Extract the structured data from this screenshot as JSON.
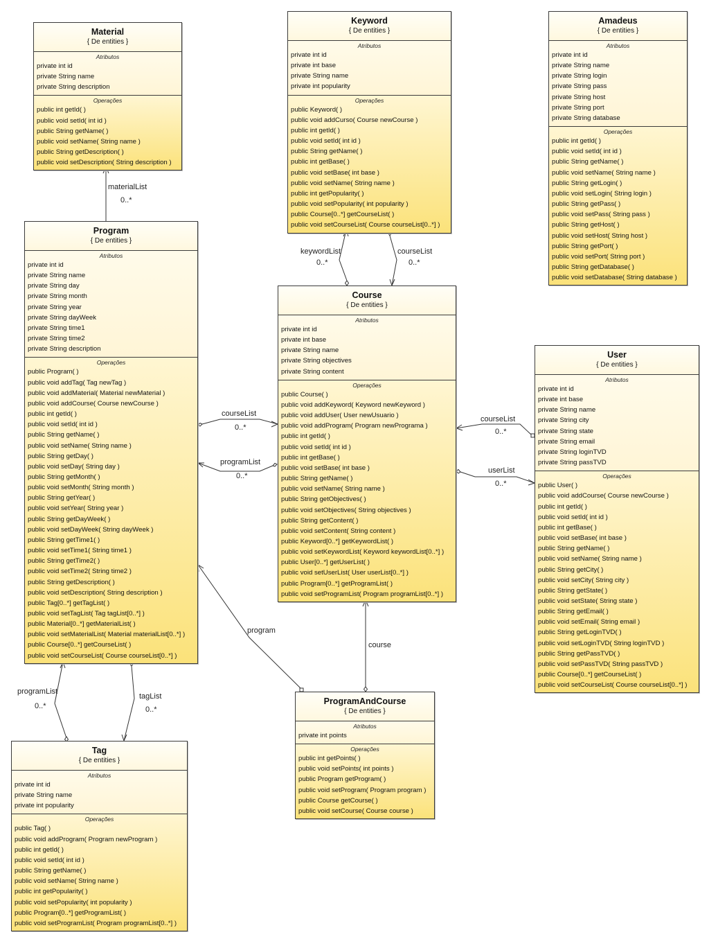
{
  "labels": {
    "attributes": "Atributos",
    "operations": "Operações"
  },
  "classes": {
    "material": {
      "name": "Material",
      "stereotype": "{ De entities }",
      "attributes": [
        "private int id",
        "private String name",
        "private String description"
      ],
      "operations": [
        "public int  getId(  )",
        "public void  setId( int id )",
        "public String  getName(  )",
        "public void  setName( String name )",
        "public String  getDescription(  )",
        "public void  setDescription( String description )"
      ]
    },
    "keyword": {
      "name": "Keyword",
      "stereotype": "{ De entities }",
      "attributes": [
        "private int id",
        "private int base",
        "private String name",
        "private int popularity"
      ],
      "operations": [
        "public Keyword(  )",
        "public void  addCurso( Course newCourse )",
        "public int  getId(  )",
        "public void  setId( int id )",
        "public String  getName(  )",
        "public int  getBase(  )",
        "public void  setBase( int base )",
        "public void  setName( String name )",
        "public int  getPopularity(  )",
        "public void  setPopularity( int popularity )",
        "public Course[0..*]  getCourseList(  )",
        "public void  setCourseList( Course courseList[0..*] )"
      ]
    },
    "amadeus": {
      "name": "Amadeus",
      "stereotype": "{ De entities }",
      "attributes": [
        "private int id",
        "private String name",
        "private String login",
        "private String pass",
        "private String host",
        "private String port",
        "private String database"
      ],
      "operations": [
        "public int  getId(  )",
        "public void  setId( int id )",
        "public String  getName(  )",
        "public void  setName( String name )",
        "public String  getLogin(  )",
        "public void  setLogin( String login )",
        "public String  getPass(  )",
        "public void  setPass( String pass )",
        "public String  getHost(  )",
        "public void  setHost( String host )",
        "public String  getPort(  )",
        "public void  setPort( String port )",
        "public String  getDatabase(  )",
        "public void  setDatabase( String database )"
      ]
    },
    "program": {
      "name": "Program",
      "stereotype": "{ De entities }",
      "attributes": [
        "private int id",
        "private String name",
        "private String day",
        "private String month",
        "private String year",
        "private String dayWeek",
        "private String time1",
        "private String time2",
        "private String description"
      ],
      "operations": [
        "public Program(  )",
        "public void  addTag( Tag newTag )",
        "public void  addMaterial( Material newMaterial )",
        "public void  addCourse( Course newCourse )",
        "public int  getId(  )",
        "public void  setId( int id )",
        "public String  getName(  )",
        "public void  setName( String name )",
        "public String  getDay(  )",
        "public void  setDay( String day )",
        "public String  getMonth(  )",
        "public void  setMonth( String month )",
        "public String  getYear(  )",
        "public void  setYear( String year )",
        "public String  getDayWeek(  )",
        "public void  setDayWeek( String dayWeek )",
        "public String  getTime1(  )",
        "public void  setTime1( String time1 )",
        "public String  getTime2(  )",
        "public void  setTime2( String time2 )",
        "public String  getDescription(  )",
        "public void  setDescription( String description )",
        "public Tag[0..*]  getTagList(  )",
        "public void  setTagList( Tag tagList[0..*] )",
        "public Material[0..*]  getMaterialList(  )",
        "public void  setMaterialList( Material materialList[0..*] )",
        "public Course[0..*]  getCourseList(  )",
        "public void  setCourseList( Course courseList[0..*] )"
      ]
    },
    "course": {
      "name": "Course",
      "stereotype": "{ De entities }",
      "attributes": [
        "private int id",
        "private int base",
        "private String name",
        "private String objectives",
        "private String content"
      ],
      "operations": [
        "public Course(  )",
        "public void  addKeyword( Keyword newKeyword )",
        "public void  addUser( User newUsuario )",
        "public void  addProgram( Program newPrograma )",
        "public int  getId(  )",
        "public void  setId( int id )",
        "public int  getBase(  )",
        "public void  setBase( int base )",
        "public String  getName(  )",
        "public void  setName( String name )",
        "public String  getObjectives(  )",
        "public void  setObjectives( String objectives )",
        "public String  getContent(  )",
        "public void  setContent( String content )",
        "public Keyword[0..*]  getKeywordList(  )",
        "public void  setKeywordList( Keyword keywordList[0..*] )",
        "public User[0..*]  getUserList(  )",
        "public void  setUserList( User userList[0..*] )",
        "public Program[0..*]  getProgramList(  )",
        "public void  setProgramList( Program programList[0..*] )"
      ]
    },
    "user": {
      "name": "User",
      "stereotype": "{ De entities }",
      "attributes": [
        "private int id",
        "private int base",
        "private String name",
        "private String city",
        "private String state",
        "private String email",
        "private String loginTVD",
        "private String passTVD"
      ],
      "operations": [
        "public User(  )",
        "public void  addCourse( Course newCourse )",
        "public int  getId(  )",
        "public void  setId( int id )",
        "public int  getBase(  )",
        "public void  setBase( int base )",
        "public String  getName(  )",
        "public void  setName( String name )",
        "public String  getCity(  )",
        "public void  setCity( String city )",
        "public String  getState(  )",
        "public void  setState( String state )",
        "public String  getEmail(  )",
        "public void  setEmail( String email )",
        "public String  getLoginTVD(  )",
        "public void  setLoginTVD( String loginTVD )",
        "public String  getPassTVD(  )",
        "public void  setPassTVD( String passTVD )",
        "public Course[0..*]  getCourseList(  )",
        "public void  setCourseList( Course courseList[0..*] )"
      ]
    },
    "tag": {
      "name": "Tag",
      "stereotype": "{ De entities }",
      "attributes": [
        "private int id",
        "private String name",
        "private int popularity"
      ],
      "operations": [
        "public Tag(  )",
        "public void  addProgram( Program newProgram )",
        "public int  getId(  )",
        "public void  setId( int id )",
        "public String  getName(  )",
        "public void  setName( String name )",
        "public int  getPopularity(  )",
        "public void  setPopularity( int popularity )",
        "public Program[0..*]  getProgramList(  )",
        "public void  setProgramList( Program programList[0..*] )"
      ]
    },
    "programandcourse": {
      "name": "ProgramAndCourse",
      "stereotype": "{ De entities }",
      "attributes": [
        "private int points"
      ],
      "operations": [
        "public int  getPoints(  )",
        "public void  setPoints( int points )",
        "public Program  getProgram(  )",
        "public void  setProgram( Program program )",
        "public Course  getCourse(  )",
        "public void  setCourse( Course course )"
      ]
    }
  },
  "associations": [
    {
      "id": "program-material",
      "role": "materialList",
      "multiplicity": "0..*",
      "from": "Program",
      "to": "Material"
    },
    {
      "id": "course-keyword",
      "role": "keywordList",
      "multiplicity": "0..*",
      "from": "Course",
      "to": "Keyword"
    },
    {
      "id": "keyword-course",
      "role": "courseList",
      "multiplicity": "0..*",
      "from": "Keyword",
      "to": "Course"
    },
    {
      "id": "program-course",
      "role": "courseList",
      "multiplicity": "0..*",
      "from": "Program",
      "to": "Course"
    },
    {
      "id": "course-program",
      "role": "programList",
      "multiplicity": "0..*",
      "from": "Course",
      "to": "Program"
    },
    {
      "id": "user-course",
      "role": "courseList",
      "multiplicity": "0..*",
      "from": "User",
      "to": "Course"
    },
    {
      "id": "course-user",
      "role": "userList",
      "multiplicity": "0..*",
      "from": "Course",
      "to": "User"
    },
    {
      "id": "tag-program",
      "role": "programList",
      "multiplicity": "0..*",
      "from": "Tag",
      "to": "Program"
    },
    {
      "id": "program-tag",
      "role": "tagList",
      "multiplicity": "0..*",
      "from": "Program",
      "to": "Tag"
    },
    {
      "id": "pac-program",
      "role": "program",
      "multiplicity": "",
      "from": "ProgramAndCourse",
      "to": "Program"
    },
    {
      "id": "pac-course",
      "role": "course",
      "multiplicity": "",
      "from": "ProgramAndCourse",
      "to": "Course"
    }
  ]
}
